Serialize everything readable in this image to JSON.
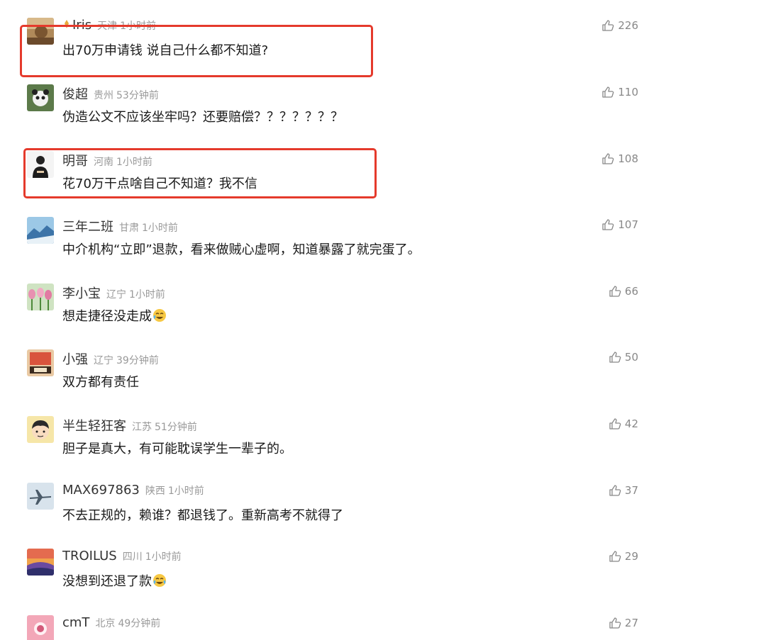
{
  "comments": [
    {
      "username": "Iris",
      "location": "天津",
      "time": "1小时前",
      "content": "出70万申请钱 说自己什么都不知道?",
      "likes": "226",
      "avatar": "avatar-landscape-icon"
    },
    {
      "username": "俊超",
      "location": "贵州",
      "time": "53分钟前",
      "content": "伪造公文不应该坐牢吗？还要赔偿？？？？？？？",
      "likes": "110",
      "avatar": "avatar-panda-icon"
    },
    {
      "username": "明哥",
      "location": "河南",
      "time": "1小时前",
      "content": "花70万干点啥自己不知道？我不信",
      "likes": "108",
      "avatar": "avatar-person-icon"
    },
    {
      "username": "三年二班",
      "location": "甘肃",
      "time": "1小时前",
      "content": "中介机构“立即”退款，看来做贼心虚啊，知道暴露了就完蛋了。",
      "likes": "107",
      "avatar": "avatar-mountain-icon"
    },
    {
      "username": "李小宝",
      "location": "辽宁",
      "time": "1小时前",
      "content": "想走捷径没走成",
      "likes": "66",
      "avatar": "avatar-tulips-icon",
      "emoji": "laughing-crying-emoji"
    },
    {
      "username": "小强",
      "location": "辽宁",
      "time": "39分钟前",
      "content": "双方都有责任",
      "likes": "50",
      "avatar": "avatar-badge-100-icon"
    },
    {
      "username": "半生轻狂客",
      "location": "江苏",
      "time": "51分钟前",
      "content": "胆子是真大，有可能耽误学生一辈子的。",
      "likes": "42",
      "avatar": "avatar-cartoon-boy-icon"
    },
    {
      "username": "MAX697863",
      "location": "陕西",
      "time": "1小时前",
      "content": "不去正规的，赖谁？都退钱了。重新高考不就得了",
      "likes": "37",
      "avatar": "avatar-airplane-icon"
    },
    {
      "username": "TROILUS",
      "location": "四川",
      "time": "1小时前",
      "content": "没想到还退了款",
      "likes": "29",
      "avatar": "avatar-sunset-icon",
      "emoji": "laughing-crying-emoji"
    },
    {
      "username": "cmT",
      "location": "北京",
      "time": "49分钟前",
      "content": "",
      "likes": "27",
      "avatar": "avatar-pink-icon"
    }
  ],
  "colors": {
    "highlight": "#e53a2c",
    "meta": "#999999",
    "text": "#1a1a1a"
  }
}
